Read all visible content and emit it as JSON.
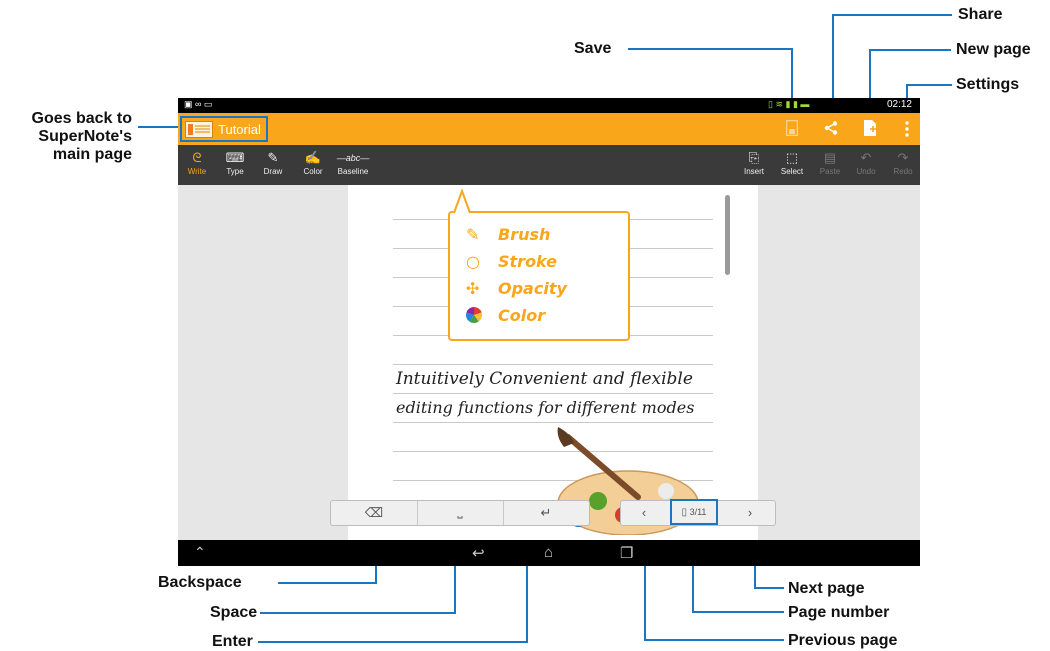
{
  "callouts": {
    "save": "Save",
    "share": "Share",
    "new_page": "New page",
    "settings": "Settings",
    "back_line1": "Goes back to",
    "back_line2": "SuperNote's",
    "back_line3": "main page",
    "backspace": "Backspace",
    "space": "Space",
    "enter": "Enter",
    "next_page": "Next page",
    "page_number": "Page number",
    "previous_page": "Previous page"
  },
  "status_bar": {
    "time": "02:12"
  },
  "title_bar": {
    "title": "Tutorial"
  },
  "toolbar": {
    "write": "Write",
    "type": "Type",
    "draw": "Draw",
    "color": "Color",
    "baseline": "Baseline",
    "insert": "Insert",
    "select": "Select",
    "paste": "Paste",
    "undo": "Undo",
    "redo": "Redo"
  },
  "tip": {
    "brush": "Brush",
    "stroke": "Stroke",
    "opacity": "Opacity",
    "color": "Color"
  },
  "note": {
    "line1": "Intuitively Convenient and flexible",
    "line2": "editing functions for different modes"
  },
  "page_indicator": "3/11",
  "colors": {
    "accent": "#f9a61b",
    "callout_line": "#1a75c2",
    "toolbar_bg": "#3a3a3a"
  }
}
